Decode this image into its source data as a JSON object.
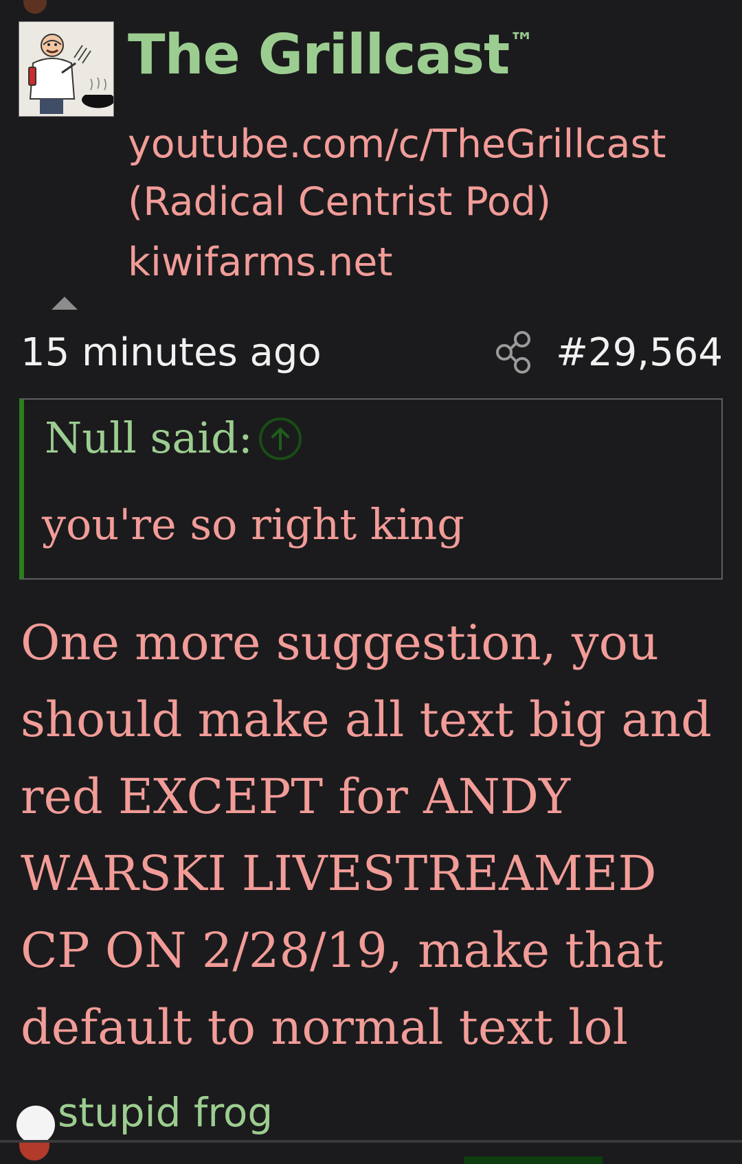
{
  "user": {
    "name": "The Grillcast",
    "trademark": "™",
    "title": "youtube.com/c/TheGrillcast\n(Radical Centrist Pod)",
    "site": "kiwifarms.net"
  },
  "post": {
    "time": "15 minutes ago",
    "number": "#29,564",
    "quote_author": "Null said:",
    "quote_text": "you're so right king",
    "body": "One more suggestion, you should make all text big and red EXCEPT for ANDY WARSKI LIVESTREAMED CP ON 2/28/19, make that default to normal text lol"
  },
  "footer": {
    "text": "stupid frog"
  },
  "colors": {
    "background": "#1b1b1d",
    "username_green": "#9ccd90",
    "text_pink": "#f29c98",
    "quote_bar": "#2e7d1f"
  }
}
